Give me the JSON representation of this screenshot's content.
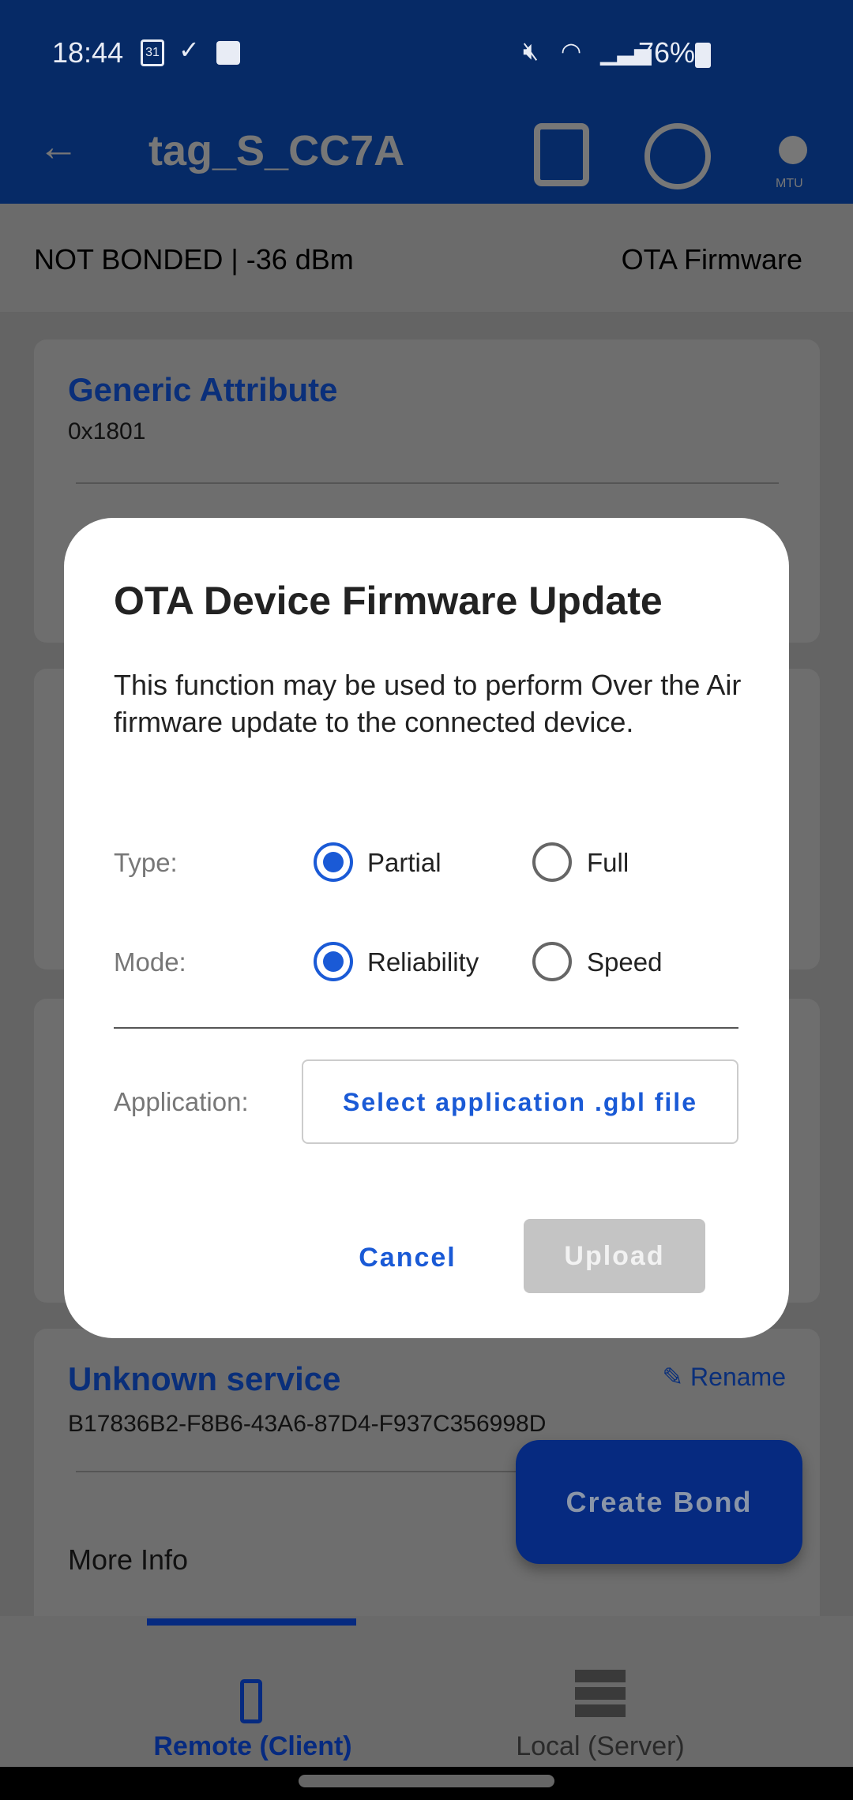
{
  "status_bar": {
    "time": "18:44",
    "calendar_day": "31",
    "battery": "76%",
    "icons": [
      "calendar-icon",
      "check-circle-icon",
      "image-icon",
      "mute-icon",
      "wifi-icon",
      "signal-icon",
      "battery-icon"
    ]
  },
  "app_bar": {
    "title": "tag_S_CC7A",
    "icons": [
      "back-arrow-icon",
      "log-clipboard-icon",
      "connection-icon",
      "mtu-icon"
    ],
    "mtu_label": "MTU"
  },
  "info_bar": {
    "status": "NOT BONDED | -36 dBm",
    "ota": "OTA Firmware"
  },
  "services": [
    {
      "name": "Generic Attribute",
      "uuid": "0x1801"
    },
    {
      "name": "Unknown service",
      "uuid": "B17836B2-F8B6-43A6-87D4-F937C356998D",
      "rename": "Rename",
      "more": "More Info"
    }
  ],
  "dialog": {
    "title": "OTA Device Firmware Update",
    "body": "This function may be used to perform Over the Air firmware update to the connected device.",
    "type_label": "Type:",
    "type_options": [
      "Partial",
      "Full"
    ],
    "type_selected": "Partial",
    "mode_label": "Mode:",
    "mode_options": [
      "Reliability",
      "Speed"
    ],
    "mode_selected": "Reliability",
    "app_label": "Application:",
    "select_file": "Select application .gbl file",
    "cancel": "Cancel",
    "upload": "Upload"
  },
  "fab": {
    "label": "Create Bond"
  },
  "bottom_nav": [
    {
      "label": "Remote (Client)",
      "active": true
    },
    {
      "label": "Local (Server)",
      "active": false
    }
  ],
  "colors": {
    "accent": "#1a5ad6",
    "header": "#062a66"
  }
}
